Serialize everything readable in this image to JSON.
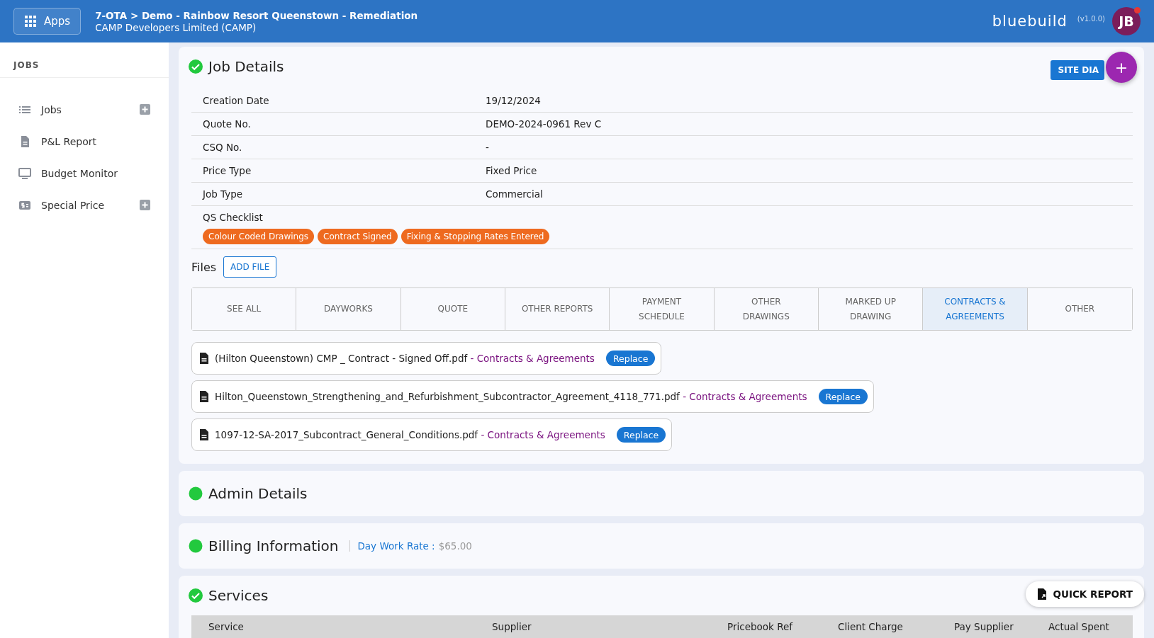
{
  "header": {
    "apps_button": "Apps",
    "breadcrumb": "7-OTA > Demo - Rainbow Resort Queenstown - Remediation",
    "client": "CAMP Developers Limited (CAMP)",
    "brand": "bluebuild",
    "version": "(v1.0.0)",
    "avatar": "JB",
    "notification": true
  },
  "sidebar": {
    "heading": "JOBS",
    "items": [
      {
        "label": "Jobs",
        "add": true
      },
      {
        "label": "P&L Report",
        "add": false
      },
      {
        "label": "Budget Monitor",
        "add": false
      },
      {
        "label": "Special Price",
        "add": true
      }
    ]
  },
  "job_details": {
    "title": "Job Details",
    "complete": true,
    "site_button": "SITE DIA",
    "fab": "+",
    "fields": [
      {
        "label": "Creation Date",
        "value": "19/12/2024"
      },
      {
        "label": "Quote No.",
        "value": "DEMO-2024-0961 Rev C"
      },
      {
        "label": "CSQ No.",
        "value": "-"
      },
      {
        "label": "Price Type",
        "value": "Fixed Price"
      },
      {
        "label": "Job Type",
        "value": "Commercial"
      }
    ],
    "checklist": {
      "label": "QS Checklist",
      "tags": [
        "Colour Coded Drawings",
        "Contract Signed",
        "Fixing & Stopping Rates Entered"
      ]
    },
    "files": {
      "label": "Files",
      "add_button": "ADD FILE",
      "tabs": [
        {
          "label": "SEE ALL",
          "selected": false
        },
        {
          "label": "DAYWORKS",
          "selected": false
        },
        {
          "label": "QUOTE",
          "selected": false
        },
        {
          "label": "OTHER REPORTS",
          "selected": false
        },
        {
          "label": "PAYMENT SCHEDULE",
          "selected": false
        },
        {
          "label": "OTHER DRAWINGS",
          "selected": false
        },
        {
          "label": "MARKED UP DRAWING",
          "selected": false
        },
        {
          "label": "CONTRACTS & AGREEMENTS",
          "selected": true
        },
        {
          "label": "OTHER",
          "selected": false
        }
      ],
      "items": [
        {
          "name": "(Hilton Queenstown) CMP _ Contract - Signed Off.pdf",
          "category": "- Contracts & Agreements",
          "button": "Replace"
        },
        {
          "name": "Hilton_Queenstown_Strengthening_and_Refurbishment_Subcontractor_Agreement_4118_771.pdf",
          "category": "- Contracts & Agreements",
          "button": "Replace"
        },
        {
          "name": "1097-12-SA-2017_Subcontract_General_Conditions.pdf",
          "category": "- Contracts & Agreements",
          "button": "Replace"
        }
      ]
    }
  },
  "admin_details": {
    "title": "Admin Details",
    "complete": false
  },
  "billing": {
    "title": "Billing Information",
    "complete": false,
    "rate_label": "Day Work Rate :",
    "rate_value": "$65.00"
  },
  "services": {
    "title": "Services",
    "complete": true,
    "columns": [
      "Service",
      "Supplier",
      "Pricebook Ref",
      "Client Charge",
      "Pay Supplier",
      "Actual Spent"
    ]
  },
  "quick_report": "QUICK REPORT"
}
